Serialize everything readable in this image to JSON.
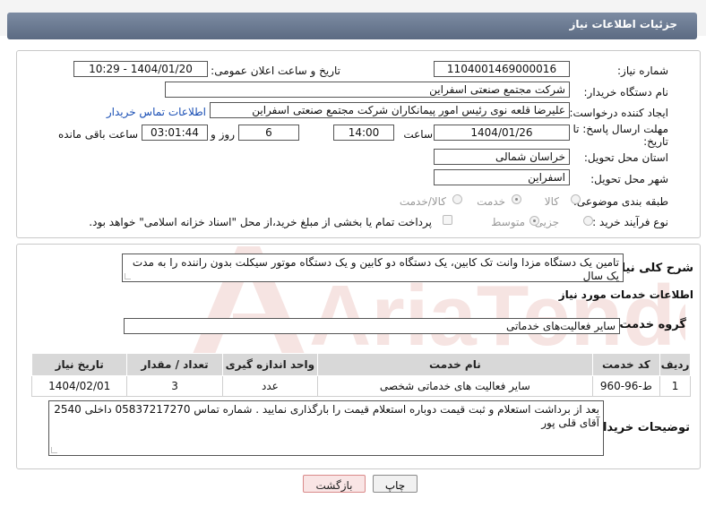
{
  "header": {
    "title": "جزئیات اطلاعات نیاز"
  },
  "form": {
    "need_number_label": "شماره نیاز:",
    "need_number": "1104001469000016",
    "announce_label": "تاریخ و ساعت اعلان عمومی:",
    "announce_value": "1404/01/20 - 10:29",
    "buyer_org_label": "نام دستگاه خریدار:",
    "buyer_org": "شرکت مجتمع صنعتی اسفراین",
    "creator_label": "ایجاد کننده درخواست:",
    "creator": "علیرضا قلعه نوی رئیس امور پیمانکاران شرکت مجتمع صنعتی اسفراین",
    "contact_link": "اطلاعات تماس خریدار",
    "deadline_label_1": "مهلت ارسال پاسخ: تا",
    "deadline_label_2": "تاریخ:",
    "deadline_date": "1404/01/26",
    "time_label": "ساعت",
    "deadline_time": "14:00",
    "days_value": "6",
    "days_label": "روز و",
    "remaining_value": "03:01:44",
    "remaining_label": "ساعت باقی مانده",
    "province_label": "استان محل تحویل:",
    "province": "خراسان شمالی",
    "city_label": "شهر محل تحویل:",
    "city": "اسفراین",
    "category_label": "طبقه بندی موضوعی:",
    "category_options": [
      "کالا",
      "خدمت",
      "کالا/خدمت"
    ],
    "category_selected": "خدمت",
    "process_label": "نوع فرآیند خرید :",
    "process_options": [
      "جزیی",
      "متوسط"
    ],
    "process_selected": "متوسط",
    "payment_note": "پرداخت تمام یا بخشی از مبلغ خرید،از محل \"اسناد خزانه اسلامی\" خواهد بود."
  },
  "summary": {
    "label": "شرح کلی نیاز:",
    "text": "تامین یک دستگاه مزدا وانت تک کابین، یک دستگاه دو کابین و یک دستگاه موتور سیکلت بدون راننده را به مدت یک سال"
  },
  "services": {
    "section_title": "اطلاعات خدمات مورد نیاز",
    "group_label": "گروه خدمت:",
    "group_value": "سایر فعالیت‌های خدماتی",
    "columns": [
      "ردیف",
      "کد خدمت",
      "نام خدمت",
      "واحد اندازه گیری",
      "تعداد / مقدار",
      "تاریخ نیاز"
    ],
    "rows": [
      [
        "1",
        "ط-96-960",
        "سایر فعالیت های خدماتی شخصی",
        "عدد",
        "3",
        "1404/02/01"
      ]
    ]
  },
  "buyer_notes": {
    "label": "توضیحات خریدار:",
    "text": "بعد از برداشت  استعلام و ثبت قیمت دوباره استعلام قیمت را بارگذاری نمایید . شماره تماس 05837217270  داخلی 2540 آقای قلی پور"
  },
  "buttons": {
    "print": "چاپ",
    "back": "بازگشت"
  },
  "watermark": {
    "text": "AriaTender.net",
    "color": "#c0392b"
  }
}
